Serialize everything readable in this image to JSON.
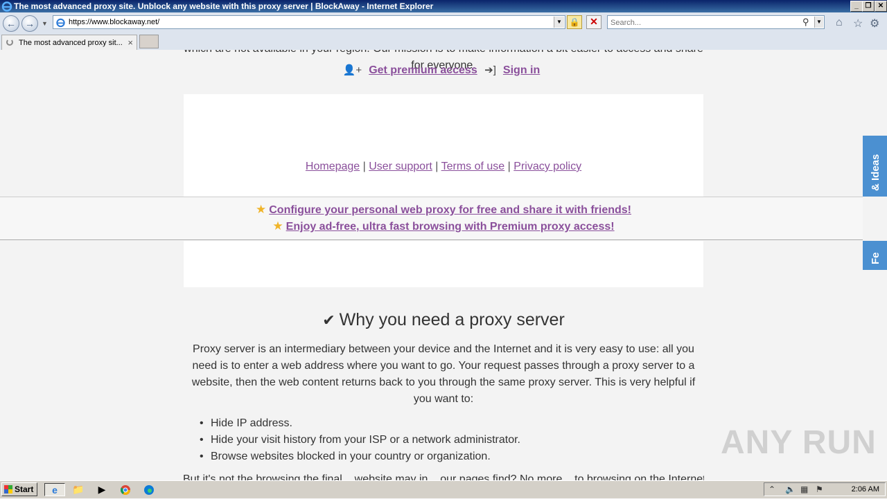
{
  "window": {
    "title": "The most advanced proxy site. Unblock any website with this proxy server | BlockAway - Internet Explorer",
    "controls": {
      "minimize": "_",
      "restore": "❐",
      "close": "✕"
    }
  },
  "address_bar": {
    "url": "https://www.blockaway.net/",
    "search_placeholder": "Search..."
  },
  "tabs": [
    {
      "label": "The most advanced proxy sit...",
      "close": "×"
    }
  ],
  "page": {
    "intro_tail": "which are not available in your region. Our mission is to make information a bit easier to access and share for everyone.",
    "account": {
      "premium": "Get premium access",
      "signin": "Sign in"
    },
    "footer_links": {
      "homepage": "Homepage",
      "support": "User support",
      "terms": "Terms of use",
      "privacy": "Privacy policy",
      "sep": "|"
    },
    "promo": {
      "line1": "Configure your personal web proxy for free and share it with friends!",
      "line2": "Enjoy ad-free, ultra fast browsing with Premium proxy access!"
    },
    "feedback": {
      "part1": "& Ideas",
      "part2": "Fe"
    },
    "section": {
      "title": "Why you need a proxy server",
      "paragraph": "Proxy server is an intermediary between your device and the Internet and it is very easy to use: all you need is to enter a web address where you want to go. Your request passes through a proxy server to a website, then the web content returns back to you through the same proxy server. This is very helpful if you want to:",
      "bullets": [
        "Hide IP address.",
        "Hide your visit history from your ISP or a network administrator.",
        "Browse websites blocked in your country or organization."
      ],
      "cut_text": "But it's not the browsing the final... website may in... our pages find? No more... to browsing on the Internet..."
    },
    "watermark": "ANY RUN"
  },
  "taskbar": {
    "start": "Start",
    "clock": "2:06 AM"
  },
  "colors": {
    "link": "#8a4f9b",
    "feedback_tab": "#4b90d1",
    "star": "#f0b429"
  }
}
